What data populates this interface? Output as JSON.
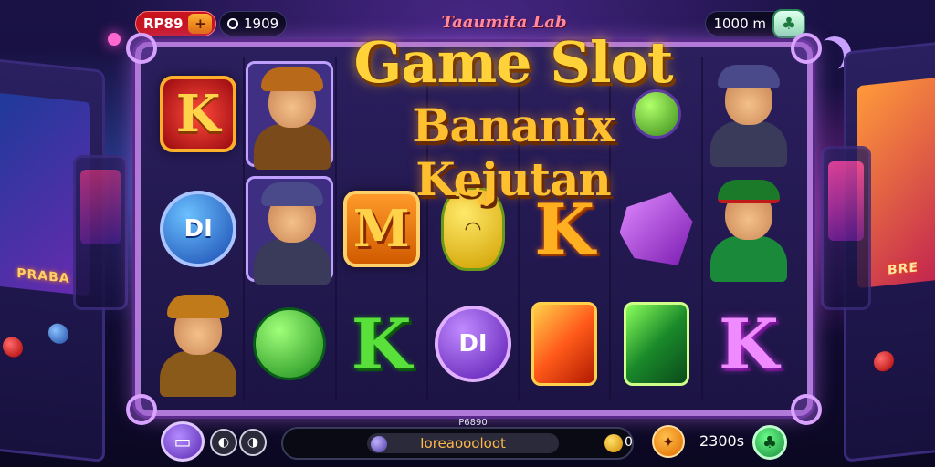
{
  "top_bar": {
    "credit_label": "RP89",
    "credit_add_icon": "plus-icon",
    "balance": "1909",
    "win_amount": "1000 m",
    "win_icon": "gem-icon",
    "clover_icon": "clover-icon"
  },
  "title": {
    "subtitle": "Taaumita Lab",
    "line1": "Game Slot",
    "line2": "Bananix Kejutan"
  },
  "reels": {
    "rows": [
      [
        "K",
        "hero-goggles",
        "",
        "",
        "",
        "",
        "hero-helmet"
      ],
      [
        "DI",
        "hero-helmet-boxed",
        "M",
        "lemon",
        "K",
        "crystal",
        "hero-green-cap"
      ],
      [
        "hero-goggles",
        "green-orb",
        "K",
        "DI",
        "fire-card",
        "jade-card",
        "K"
      ]
    ]
  },
  "arcade": {
    "left_screen": "PRABA",
    "right_screen": "BRE"
  },
  "bottom_bar": {
    "menu_icon": "bed-icon",
    "sound_icon": "sound-icon",
    "settings_icon": "settings-icon",
    "info_label": "P6890",
    "info_text": "Ioreaoooloot",
    "coin_count": "0",
    "spin_icon": "spin-icon",
    "bet_amount": "2300s",
    "bet_icon": "clover-icon"
  },
  "colors": {
    "frame": "#b27ad8",
    "title_gold": "#ffd23a",
    "credit_red": "#c8141e",
    "accent_green": "#1a8a3a"
  }
}
